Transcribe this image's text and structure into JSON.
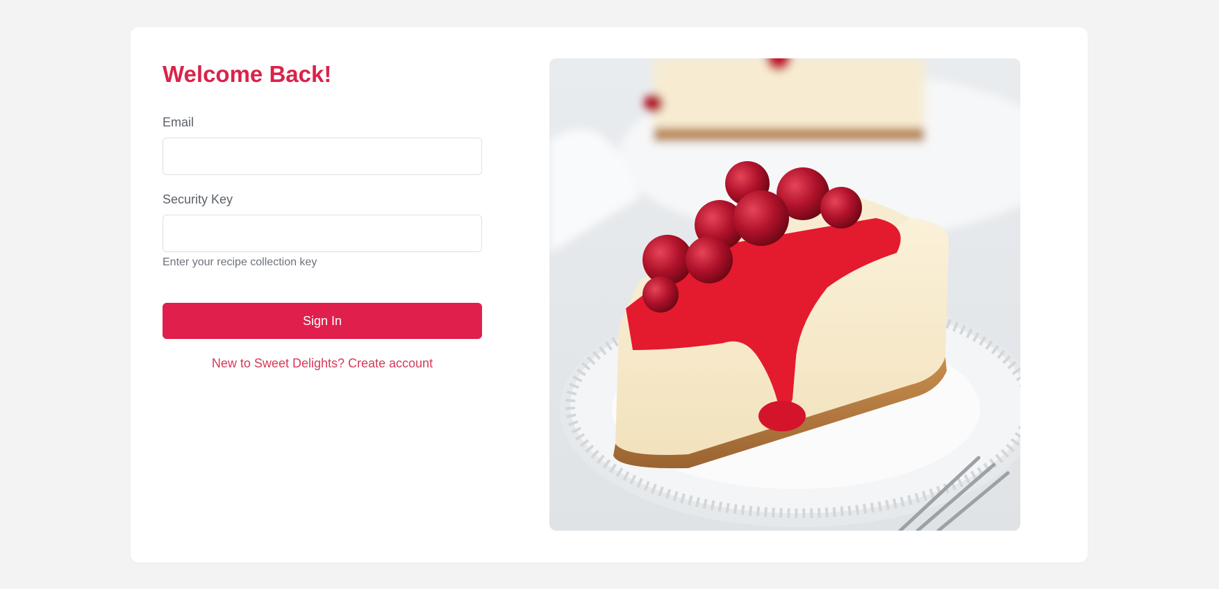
{
  "login": {
    "title": "Welcome Back!",
    "email_label": "Email",
    "email_value": "",
    "key_label": "Security Key",
    "key_value": "",
    "key_hint": "Enter your recipe collection key",
    "submit_label": "Sign In",
    "signup_link": "New to Sweet Delights? Create account"
  },
  "hero_image": {
    "subject": "cheesecake-slice-with-cherry-topping"
  },
  "colors": {
    "accent": "#e01f4c",
    "title": "#d9234a",
    "link": "#d33a59",
    "background": "#f3f3f3",
    "card": "#ffffff"
  }
}
